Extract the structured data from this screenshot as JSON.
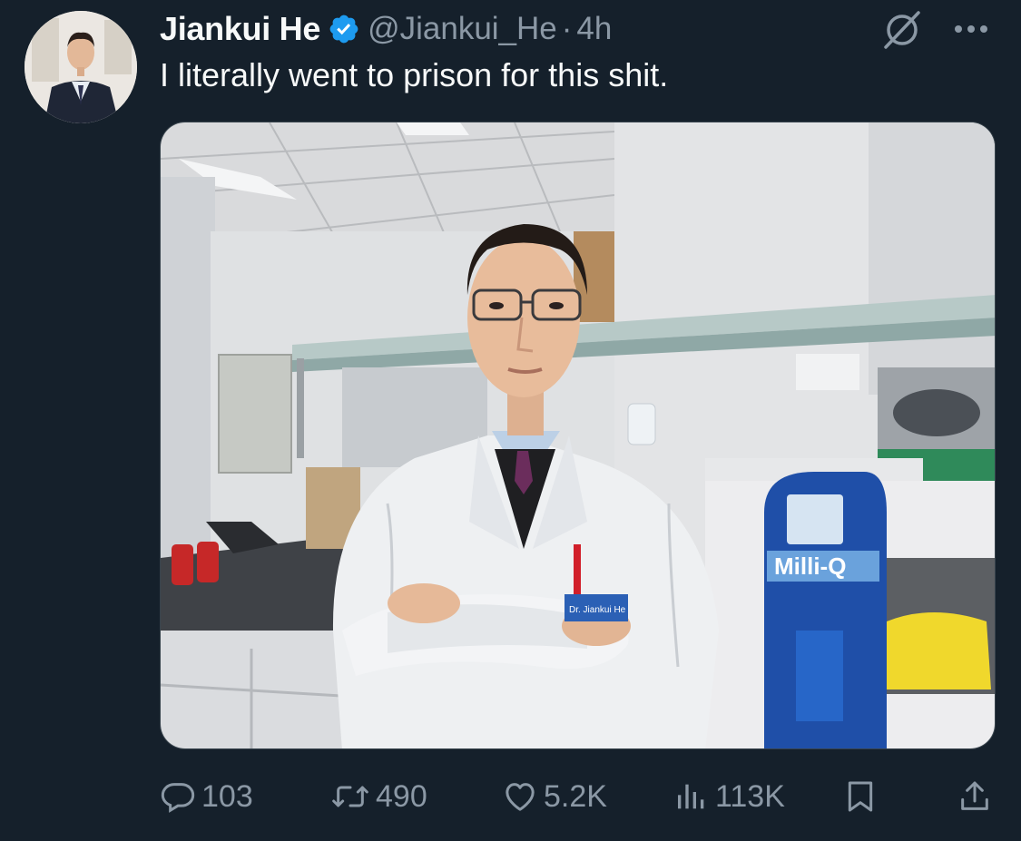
{
  "tweet": {
    "author_name": "Jiankui He",
    "handle": "@Jiankui_He",
    "separator": "·",
    "time": "4h",
    "text": "I literally went to prison for this shit."
  },
  "media": {
    "badge_text": "Dr. Jiankui He",
    "device_label": "Milli-Q"
  },
  "actions": {
    "replies": "103",
    "reposts": "490",
    "likes": "5.2K",
    "views": "113K"
  },
  "colors": {
    "background": "#15202b",
    "secondary_text": "#8b98a5",
    "verified": "#1d9bf0"
  },
  "icons": [
    "grok-icon",
    "more-icon",
    "verified-badge-icon",
    "reply-icon",
    "repost-icon",
    "like-icon",
    "views-icon",
    "bookmark-icon",
    "share-icon"
  ]
}
